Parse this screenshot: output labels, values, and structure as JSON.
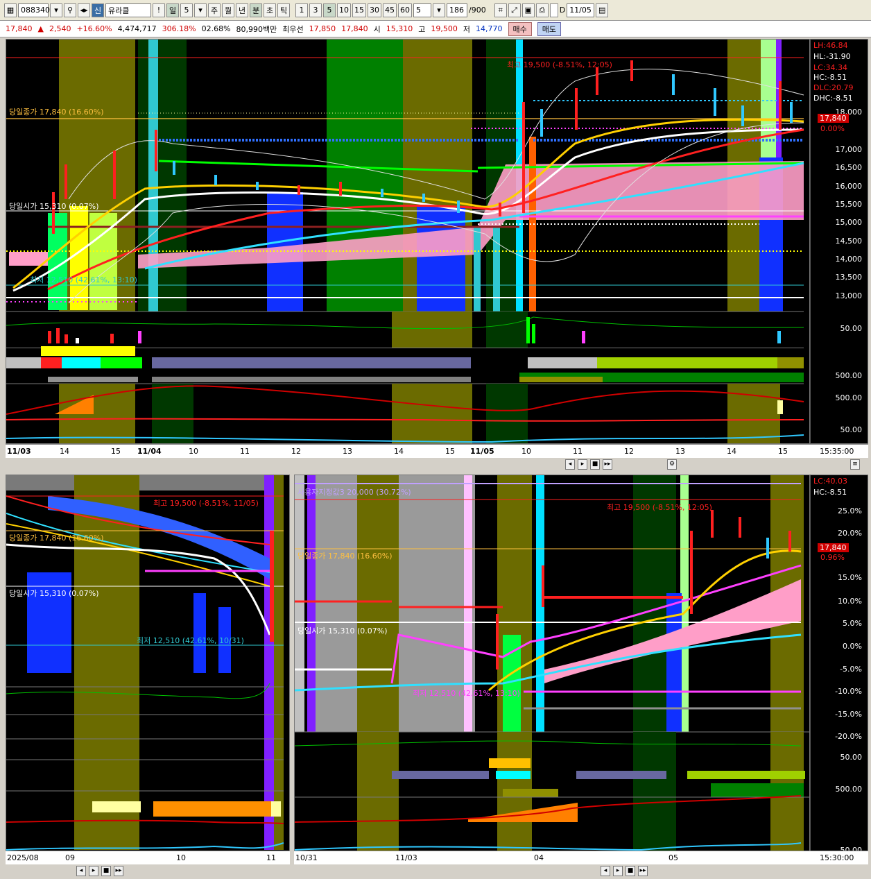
{
  "toolbar": {
    "code": "088340",
    "badge": "신",
    "name": "유라클",
    "period_label": "일",
    "period_value": "5",
    "tabs": [
      "주",
      "월",
      "년",
      "분",
      "초",
      "틱"
    ],
    "intervals": [
      "1",
      "3",
      "5",
      "10",
      "15",
      "30",
      "45",
      "60"
    ],
    "interval_value": "5",
    "count": "186",
    "count_total": "/900",
    "date_check": "D",
    "date": "11/05"
  },
  "quote": {
    "price": "17,840",
    "change": "2,540",
    "change_pct": "+16.60%",
    "volume": "4,474,717",
    "vol_ratio": "306.18%",
    "turnover": "02.68%",
    "amount": "80,990백만",
    "best_label": "최우선",
    "ask": "17,850",
    "bid": "17,840",
    "open_label": "시",
    "open": "15,310",
    "high_label": "고",
    "high": "19,500",
    "low_label": "저",
    "low": "14,770",
    "buy": "매수",
    "sell": "매도"
  },
  "colors": {
    "up": "#ff2020",
    "down": "#2060ff",
    "olive": "#6b6b00",
    "green_zone": "#006400",
    "pink_cloud": "#ff9ec8"
  },
  "top_chart": {
    "annotations": {
      "close": "당일종가 17,840 (16.60%)",
      "open": "당일시가 15,310 (0.07%)",
      "high": "최고 19,500 (-8.51%, 12:05)",
      "low": "최저 12,510 (42.61%, 13:10)"
    },
    "right_labels": [
      "LH:46.84",
      "HL:-31.90",
      "LC:34.34",
      "HC:-8.51",
      "DLC:20.79",
      "DHC:-8.51"
    ],
    "price_ticks": [
      "18,000",
      "17,000",
      "16,500",
      "16,000",
      "15,500",
      "15,000",
      "14,500",
      "14,000",
      "13,500",
      "13,000"
    ],
    "current_price": "17,840",
    "current_pct": "0.00%",
    "sub_ticks": [
      "50.00",
      "500.00",
      "500.00",
      "50.00"
    ],
    "x_ticks": [
      "11/03",
      "14",
      "15",
      "11/04",
      "10",
      "11",
      "12",
      "13",
      "14",
      "15",
      "11/05",
      "10",
      "11",
      "12",
      "13",
      "14",
      "15"
    ],
    "time": "15:35:00"
  },
  "bottom_left": {
    "annotations": {
      "high": "최고 19,500 (-8.51%, 11/05)",
      "close": "당일종가 17,840 (16.60%)",
      "open": "당일시가 15,310 (0.07%)",
      "low": "최저 12,510 (42.61%, 10/31)"
    },
    "x_ticks": [
      "2025/08",
      "09",
      "10",
      "11"
    ]
  },
  "bottom_right": {
    "annotations": {
      "vi": "사용자지정값3 20,000 (30.72%)",
      "high": "최고 19,500 (-8.51%, 12:05)",
      "close": "당일종가 17,840 (16.60%)",
      "open": "당일시가 15,310 (0.07%)",
      "low": "최저 12,510 (42.61%, 13:10)"
    },
    "right_labels": [
      "LC:40.03",
      "HC:-8.51"
    ],
    "pct_ticks": [
      "25.0%",
      "20.0%",
      "15.0%",
      "10.0%",
      "5.0%",
      "0.0%",
      "-5.0%",
      "-10.0%",
      "-15.0%",
      "-20.0%"
    ],
    "current_price": "17,840",
    "current_pct": "0.96%",
    "sub_ticks": [
      "50.00",
      "500.00",
      "50.00"
    ],
    "x_ticks": [
      "10/31",
      "11/03",
      "04",
      "05"
    ],
    "time": "15:30:00"
  }
}
